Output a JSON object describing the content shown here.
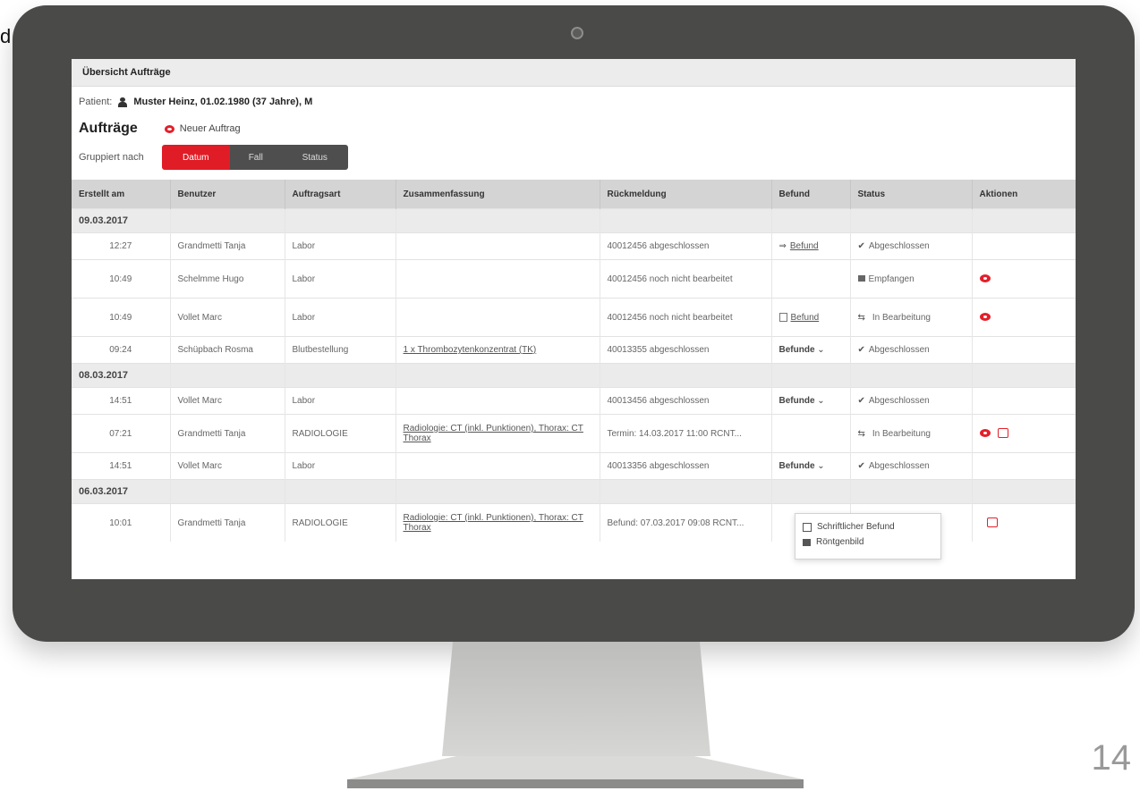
{
  "edge_letter": "d",
  "page_number": "14",
  "header": {
    "title": "Übersicht Aufträge"
  },
  "patient": {
    "label": "Patient:",
    "name": "Muster Heinz, 01.02.1980 (37 Jahre), M"
  },
  "orders": {
    "title": "Aufträge",
    "new_order_label": "Neuer Auftrag"
  },
  "grouping": {
    "label": "Gruppiert nach",
    "options": [
      "Datum",
      "Fall",
      "Status"
    ],
    "selected": "Datum"
  },
  "table": {
    "columns": [
      "Erstellt am",
      "Benutzer",
      "Auftragsart",
      "Zusammenfassung",
      "Rückmeldung",
      "Befund",
      "Status",
      "Aktionen"
    ],
    "groups": [
      {
        "date": "09.03.2017",
        "rows": [
          {
            "time": "12:27",
            "user": "Grandmetti Tanja",
            "type": "Labor",
            "summary": "",
            "feedback": "40012456 abgeschlossen",
            "finding": "Befund",
            "status": "Abgeschlossen"
          },
          {
            "time": "10:49",
            "user": "Schelmme Hugo",
            "type": "Labor",
            "summary": "",
            "feedback": "40012456 noch nicht bearbeitet",
            "finding": "",
            "status": "Empfangen"
          },
          {
            "time": "10:49",
            "user": "Vollet Marc",
            "type": "Labor",
            "summary": "",
            "feedback": "40012456 noch nicht bearbeitet",
            "finding": "Befund",
            "status": "In Bearbeitung"
          },
          {
            "time": "09:24",
            "user": "Schüpbach Rosma",
            "type": "Blutbestellung",
            "summary": "1 x Thrombozytenkonzentrat (TK)",
            "feedback": "40013355 abgeschlossen",
            "finding": "Befunde",
            "status": "Abgeschlossen"
          }
        ]
      },
      {
        "date": "08.03.2017",
        "rows": [
          {
            "time": "14:51",
            "user": "Vollet Marc",
            "type": "Labor",
            "summary": "",
            "feedback": "40013456 abgeschlossen",
            "finding": "Befunde",
            "status": "Abgeschlossen"
          },
          {
            "time": "07:21",
            "user": "Grandmetti Tanja",
            "type": "RADIOLOGIE",
            "summary": "Radiologie: CT (inkl. Punktionen), Thorax: CT Thorax",
            "feedback": "Termin: 14.03.2017 11:00 RCNT...",
            "finding": "",
            "status": "In Bearbeitung"
          },
          {
            "time": "14:51",
            "user": "Vollet Marc",
            "type": "Labor",
            "summary": "",
            "feedback": "40013356 abgeschlossen",
            "finding": "Befunde",
            "status": "Abgeschlossen"
          }
        ]
      },
      {
        "date": "06.03.2017",
        "rows": [
          {
            "time": "10:01",
            "user": "Grandmetti Tanja",
            "type": "RADIOLOGIE",
            "summary": "Radiologie: CT (inkl. Punktionen), Thorax: CT Thorax",
            "feedback": "Befund: 07.03.2017 09:08 RCNT...",
            "finding": "",
            "status": ""
          }
        ]
      }
    ]
  },
  "dropdown": {
    "items": [
      "Schriftlicher Befund",
      "Röntgenbild"
    ]
  }
}
